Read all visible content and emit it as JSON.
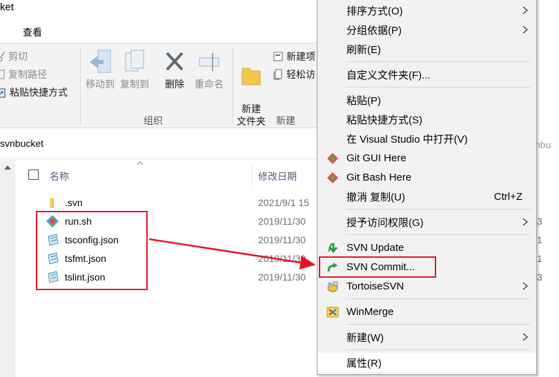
{
  "window": {
    "title": "ket",
    "tab_view": "查看"
  },
  "ribbon": {
    "cut": "剪切",
    "copy_path": "复制路径",
    "paste_shortcut": "粘贴快捷方式",
    "move_to": "移动到",
    "copy_to": "复制到",
    "delete": "删除",
    "rename": "重命名",
    "new_folder": "新建\n文件夹",
    "new_item": "新建项",
    "easy_access": "轻松访",
    "group_organize": "组织",
    "group_new": "新建"
  },
  "address": {
    "path": "svnbucket",
    "right_fragment": "nbu"
  },
  "file_list": {
    "header_name": "名称",
    "header_date": "修改日期",
    "files": [
      {
        "name": ".svn",
        "date": "2021/9/1 15",
        "icon": "folder-icon",
        "size": ""
      },
      {
        "name": "run.sh",
        "date": "2019/11/30",
        "icon": "git-script-icon",
        "size": "3"
      },
      {
        "name": "tsconfig.json",
        "date": "2019/11/30",
        "icon": "json-file-icon",
        "size": "1"
      },
      {
        "name": "tsfmt.json",
        "date": "2019/11/30",
        "icon": "json-file-icon",
        "size": "1"
      },
      {
        "name": "tslint.json",
        "date": "2019/11/30",
        "icon": "json-file-icon",
        "size": "3"
      }
    ]
  },
  "context_menu": {
    "items": [
      {
        "label": "排序方式(O)",
        "submenu": true
      },
      {
        "label": "分组依据(P)",
        "submenu": true
      },
      {
        "label": "刷新(E)"
      },
      {
        "label": "自定义文件夹(F)..."
      },
      {
        "label": "粘贴(P)"
      },
      {
        "label": "粘贴快捷方式(S)"
      },
      {
        "label": "在 Visual Studio 中打开(V)"
      },
      {
        "label": "Git GUI Here",
        "icon": "git-gui-icon"
      },
      {
        "label": "Git Bash Here",
        "icon": "git-bash-icon"
      },
      {
        "label": "撤消 复制(U)",
        "shortcut": "Ctrl+Z"
      },
      {
        "label": "授予访问权限(G)",
        "submenu": true
      },
      {
        "label": "SVN Update",
        "icon": "svn-update-icon"
      },
      {
        "label": "SVN Commit...",
        "icon": "svn-commit-icon"
      },
      {
        "label": "TortoiseSVN",
        "icon": "tortoisesvn-icon",
        "submenu": true
      },
      {
        "label": "WinMerge",
        "icon": "winmerge-icon"
      },
      {
        "label": "新建(W)",
        "submenu": true
      },
      {
        "label": "属性(R)"
      }
    ]
  },
  "annotation_color": "#e81123"
}
